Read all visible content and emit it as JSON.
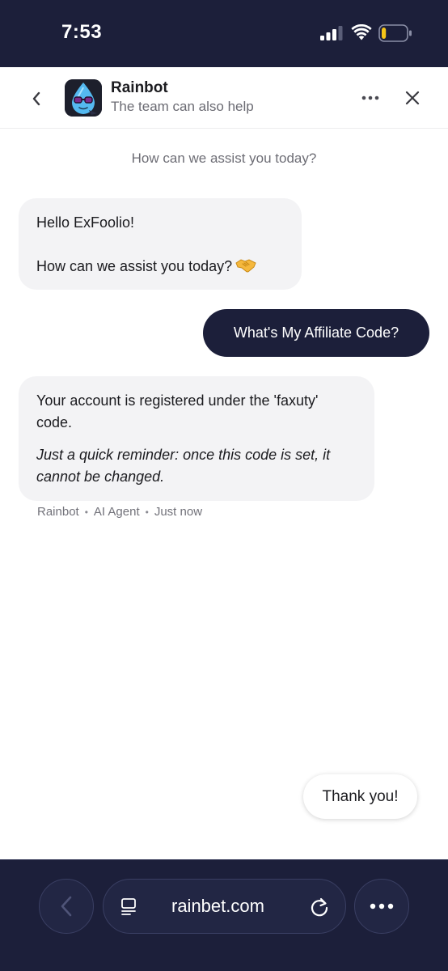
{
  "status_bar": {
    "time": "7:53",
    "signal_icon": "cellular-signal-icon",
    "wifi_icon": "wifi-icon",
    "battery_icon": "battery-low-icon",
    "battery_level": 0.18,
    "battery_color": "#f5c518"
  },
  "header": {
    "back_icon": "chevron-left-icon",
    "avatar_icon": "rainbot-avatar-icon",
    "title": "Rainbot",
    "subtitle": "The team can also help",
    "more_icon": "ellipsis-icon",
    "close_icon": "close-icon"
  },
  "conversation": {
    "intro": "How can we assist you today?",
    "greeting": {
      "line1": "Hello ExFoolio!",
      "line2": "How can we assist you today?",
      "emoji_icon": "handshake-icon"
    },
    "user_message": "What's My Affiliate Code?",
    "reply": {
      "line1": "Your account is registered under the 'faxuty' code.",
      "reminder": "Just a quick reminder: once this code is set, it cannot be changed."
    },
    "meta": {
      "sender": "Rainbot",
      "role": "AI Agent",
      "time": "Just now",
      "separator": "•"
    },
    "quick_reply": "Thank you!"
  },
  "browser_bar": {
    "back_icon": "chevron-left-icon",
    "tabs_icon": "tabs-icon",
    "url": "rainbet.com",
    "reload_icon": "reload-icon",
    "more_icon": "ellipsis-icon"
  },
  "colors": {
    "brand_dark": "#1c1f3a",
    "bot_bubble": "#f3f3f5",
    "user_bubble": "#1c1f3a"
  }
}
